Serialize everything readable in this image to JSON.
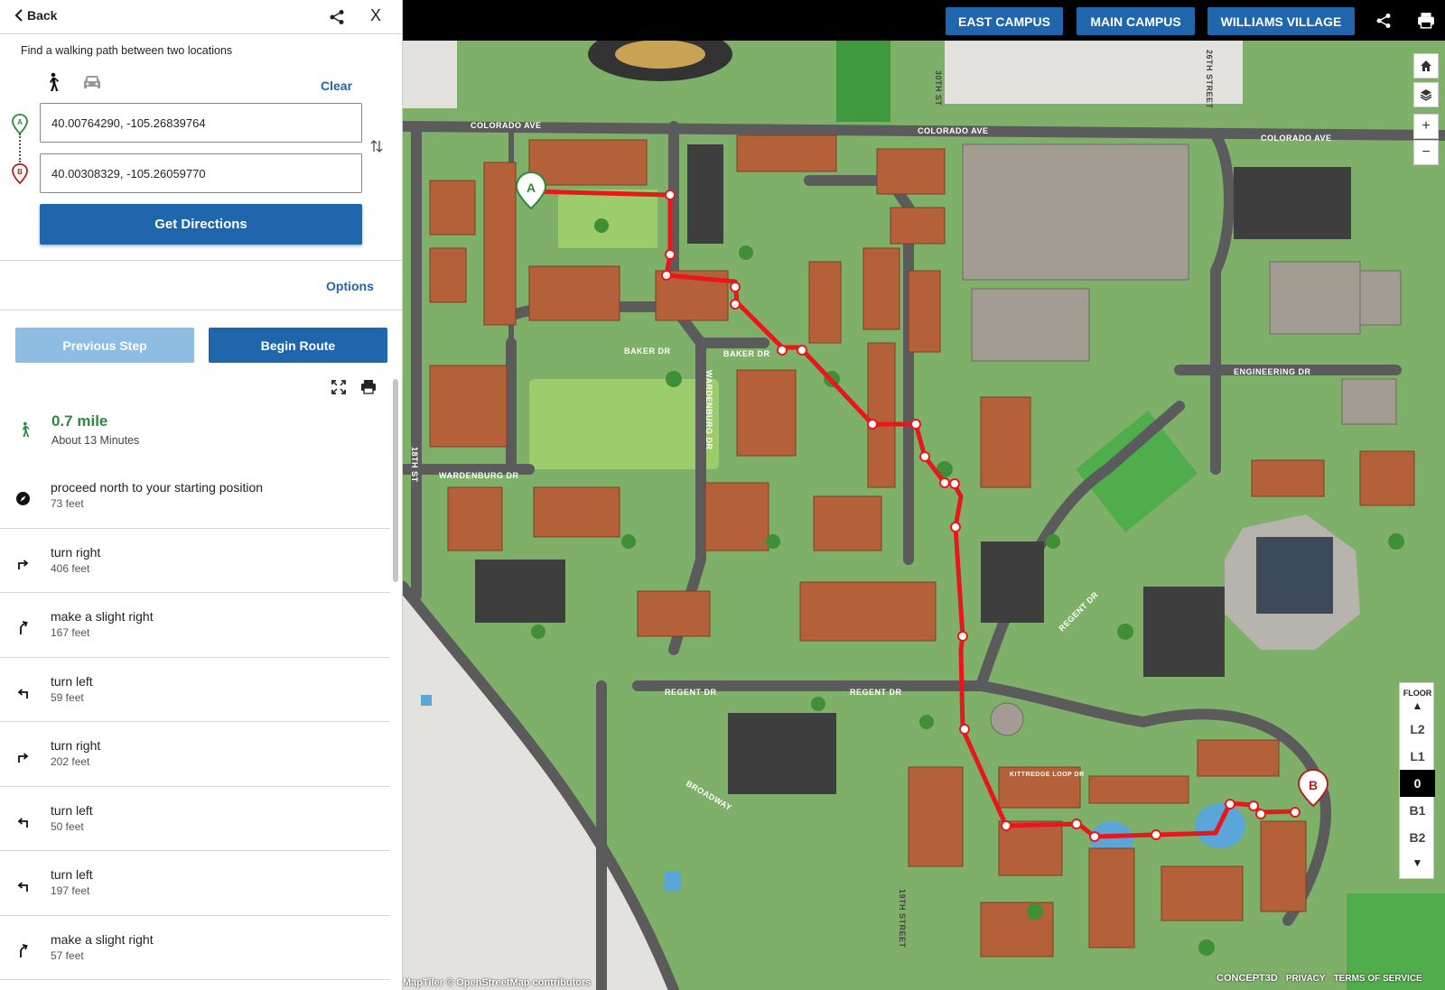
{
  "panel": {
    "back_label": "Back",
    "close_label": "X",
    "subtitle": "Find a walking path between two locations",
    "clear_label": "Clear",
    "start": {
      "pin_label": "A",
      "value": "40.00764290, -105.26839764"
    },
    "end": {
      "pin_label": "B",
      "value": "40.00308329, -105.26059770"
    },
    "get_directions_label": "Get Directions",
    "options_label": "Options",
    "previous_step_label": "Previous Step",
    "begin_route_label": "Begin Route",
    "summary": {
      "distance": "0.7 mile",
      "time": "About 13 Minutes"
    },
    "steps": [
      {
        "icon": "compass-icon",
        "text": "proceed north to your starting position",
        "distance": "73 feet"
      },
      {
        "icon": "turn-right-icon",
        "text": "turn right",
        "distance": "406 feet"
      },
      {
        "icon": "slight-right-icon",
        "text": "make a slight right",
        "distance": "167 feet"
      },
      {
        "icon": "turn-left-icon",
        "text": "turn left",
        "distance": "59 feet"
      },
      {
        "icon": "turn-right-icon",
        "text": "turn right",
        "distance": "202 feet"
      },
      {
        "icon": "turn-left-icon",
        "text": "turn left",
        "distance": "50 feet"
      },
      {
        "icon": "turn-left-icon",
        "text": "turn left",
        "distance": "197 feet"
      },
      {
        "icon": "slight-right-icon",
        "text": "make a slight right",
        "distance": "57 feet"
      }
    ]
  },
  "map": {
    "campus_buttons": [
      "EAST CAMPUS",
      "MAIN CAMPUS",
      "WILLIAMS VILLAGE"
    ],
    "controls": [
      "home-icon",
      "layers-icon",
      "zoom-in-icon",
      "zoom-out-icon"
    ],
    "zoom_in_label": "+",
    "zoom_out_label": "−",
    "floor": {
      "label": "FLOOR",
      "levels": [
        "L2",
        "L1",
        "0",
        "B1",
        "B2"
      ],
      "active": "0"
    },
    "markers": {
      "start": "A",
      "end": "B"
    },
    "streets": {
      "colorado_ave": "COLORADO AVE",
      "baker_dr": "BAKER DR",
      "wardenburg_dr": "WARDENBURG DR",
      "wardenburg_dr_v": "WARDENBURG DR",
      "regent_dr": "REGENT DR",
      "engineering_dr": "ENGINEERING DR",
      "broadway": "BROADWAY",
      "street_18th": "18TH ST",
      "street_19th": "19TH STREET",
      "street_26th": "26TH STREET",
      "street_30th": "30TH ST",
      "kittredge_loop": "KITTREDGE LOOP DR"
    },
    "attribution": "MapTiler © OpenStreetMap contributors",
    "footer": {
      "brand": "CONCEPT3D",
      "privacy": "PRIVACY",
      "terms": "TERMS OF SERVICE"
    },
    "colors": {
      "route": "#e8171b",
      "accent": "#1f66ac",
      "start_pin": "#2b8a3e",
      "end_pin": "#b22222"
    }
  }
}
